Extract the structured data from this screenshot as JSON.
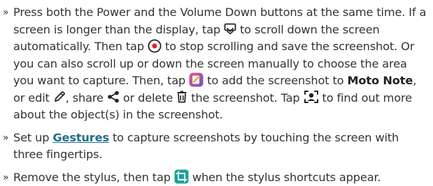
{
  "bullet_glyph": "»",
  "items": [
    {
      "seg1": "Press both the Power and the Volume Down buttons at the same time. If a screen is longer than the display, tap",
      "seg2": "to scroll down the screen automatically. Then tap",
      "seg3": "to stop scrolling and save the screenshot. Or you can also scroll up or down the screen manually to choose the area you want to capture. Then, tap",
      "seg4": "to add the screenshot to",
      "moto_note": "Moto Note",
      "seg5": ", or edit",
      "seg6": ", share",
      "seg7": "or delete",
      "seg8": "the screenshot. Tap",
      "seg9": "to find out more about the object(s) in the screenshot."
    },
    {
      "seg1": "Set up",
      "link": "Gestures",
      "seg2": "to capture screenshots by touching the screen with three fingertips."
    },
    {
      "seg1": "Remove the stylus, then tap",
      "seg2": "when the stylus shortcuts appear."
    }
  ],
  "icons": {
    "scroll_capture": "scroll-capture-icon",
    "stop_record": "stop-record-icon",
    "moto_note_app": "moto-note-icon",
    "edit": "pencil-icon",
    "share": "share-icon",
    "delete": "trash-icon",
    "lens": "lens-icon",
    "stylus_screenshot": "stylus-screenshot-icon"
  },
  "colors": {
    "text": "#333333",
    "link": "#1f6e8c",
    "record_red": "#d9282f",
    "moto_note_purple": "#7a4fb8",
    "moto_note_pink": "#e05a8a",
    "stylus_teal": "#1aa39a"
  }
}
